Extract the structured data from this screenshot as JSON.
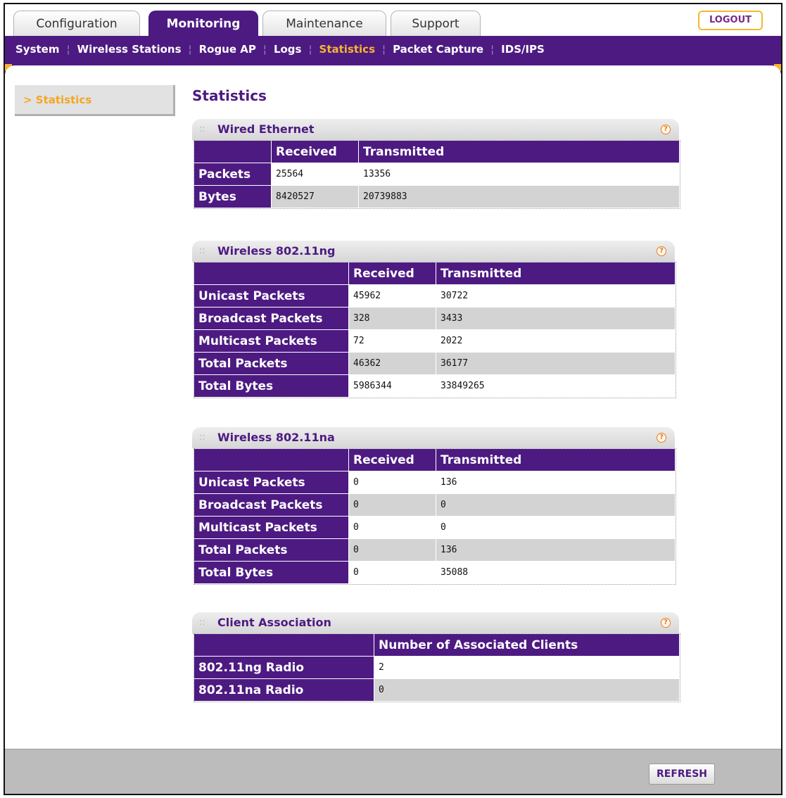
{
  "tabs": [
    {
      "label": "Configuration"
    },
    {
      "label": "Monitoring"
    },
    {
      "label": "Maintenance"
    },
    {
      "label": "Support"
    }
  ],
  "logout_label": "LOGOUT",
  "subnav": [
    {
      "label": "System"
    },
    {
      "label": "Wireless Stations"
    },
    {
      "label": "Rogue AP"
    },
    {
      "label": "Logs"
    },
    {
      "label": "Statistics"
    },
    {
      "label": "Packet Capture"
    },
    {
      "label": "IDS/IPS"
    }
  ],
  "sidebar": {
    "item": "> Statistics"
  },
  "page_title": "Statistics",
  "sections": {
    "wired": {
      "title": "Wired Ethernet",
      "columns": [
        "Received",
        "Transmitted"
      ],
      "rows": [
        {
          "label": "Packets",
          "received": "25564",
          "transmitted": "13356"
        },
        {
          "label": "Bytes",
          "received": "8420527",
          "transmitted": "20739883"
        }
      ]
    },
    "ng": {
      "title": "Wireless 802.11ng",
      "columns": [
        "Received",
        "Transmitted"
      ],
      "rows": [
        {
          "label": "Unicast Packets",
          "received": "45962",
          "transmitted": "30722"
        },
        {
          "label": "Broadcast Packets",
          "received": "328",
          "transmitted": "3433"
        },
        {
          "label": "Multicast Packets",
          "received": "72",
          "transmitted": "2022"
        },
        {
          "label": "Total Packets",
          "received": "46362",
          "transmitted": "36177"
        },
        {
          "label": "Total Bytes",
          "received": "5986344",
          "transmitted": "33849265"
        }
      ]
    },
    "na": {
      "title": "Wireless 802.11na",
      "columns": [
        "Received",
        "Transmitted"
      ],
      "rows": [
        {
          "label": "Unicast Packets",
          "received": "0",
          "transmitted": "136"
        },
        {
          "label": "Broadcast Packets",
          "received": "0",
          "transmitted": "0"
        },
        {
          "label": "Multicast Packets",
          "received": "0",
          "transmitted": "0"
        },
        {
          "label": "Total Packets",
          "received": "0",
          "transmitted": "136"
        },
        {
          "label": "Total Bytes",
          "received": "0",
          "transmitted": "35088"
        }
      ]
    },
    "clients": {
      "title": "Client Association",
      "columns": [
        "Number of Associated Clients"
      ],
      "rows": [
        {
          "label": "802.11ng Radio",
          "value": "2"
        },
        {
          "label": "802.11na Radio",
          "value": "0"
        }
      ]
    }
  },
  "refresh_label": "REFRESH",
  "colors": {
    "brand_purple": "#4d1a82",
    "accent_orange": "#f7b52e",
    "row_alt": "#d3d3d3"
  }
}
